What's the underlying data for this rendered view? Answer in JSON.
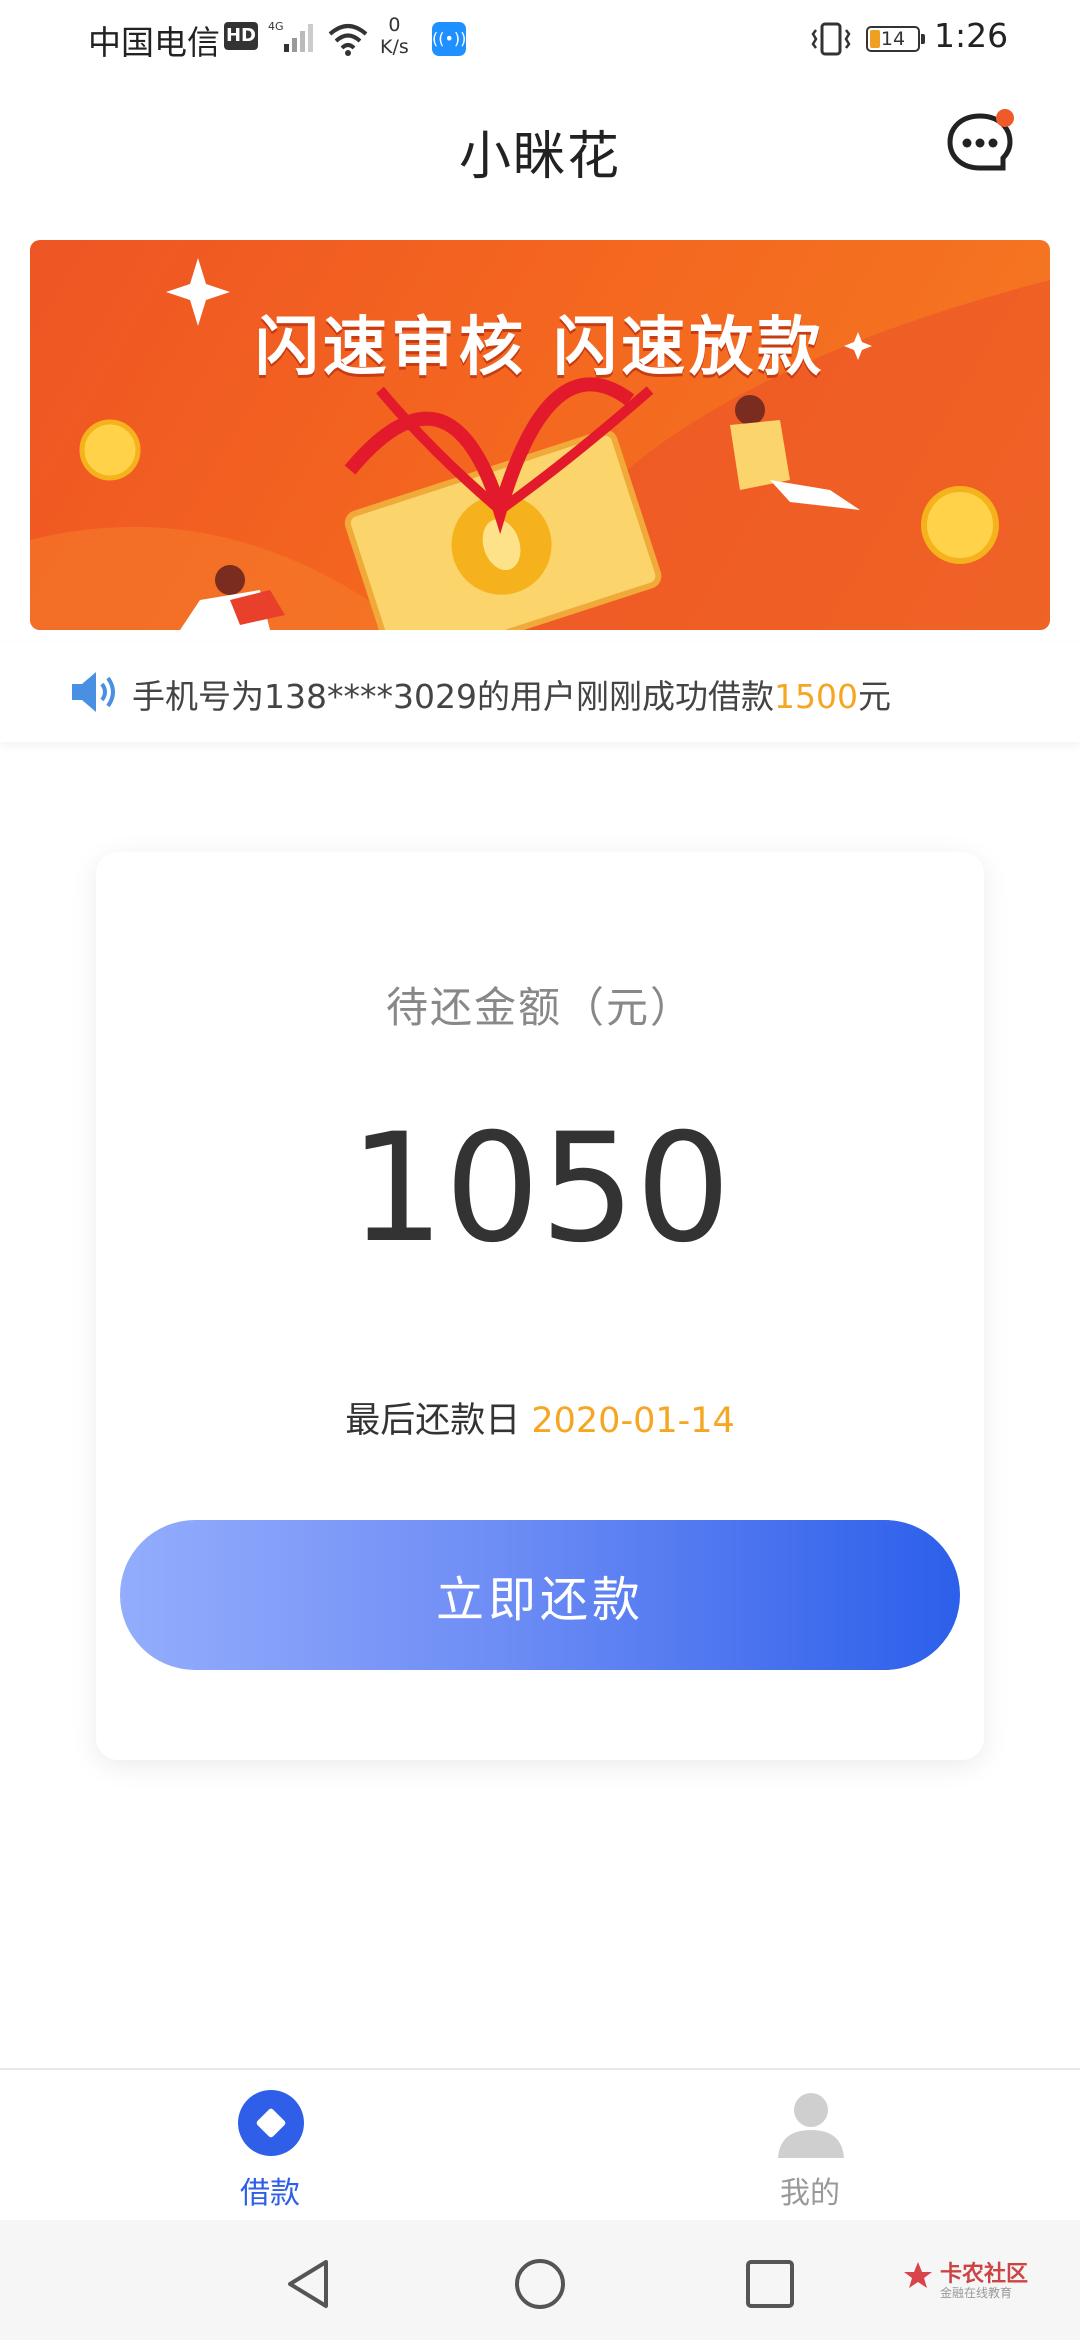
{
  "status_bar": {
    "carrier": "中国电信",
    "hd": "HD",
    "network": "4G",
    "speed_value": "0",
    "speed_unit": "K/s",
    "battery": "14",
    "time": "1:26"
  },
  "header": {
    "title": "小眯花",
    "message_icon": "chat-bubble-icon",
    "has_unread": true
  },
  "banner": {
    "headline": "闪速审核 闪速放款"
  },
  "ticker": {
    "icon": "speaker-icon",
    "prefix": "手机号为138****3029的用户刚刚成功借款",
    "amount": "1500",
    "suffix": "元"
  },
  "repayment_card": {
    "label": "待还金额（元）",
    "amount": "1050",
    "due_label": "最后还款日",
    "due_date": "2020-01-14",
    "button_label": "立即还款"
  },
  "bottom_nav": {
    "items": [
      {
        "label": "借款",
        "icon": "loan-icon",
        "active": true
      },
      {
        "label": "我的",
        "icon": "profile-icon",
        "active": false
      }
    ]
  },
  "watermark": {
    "text": "卡农社区",
    "sub": "金融在线教育"
  },
  "colors": {
    "accent_blue": "#2f5fe8",
    "highlight_orange": "#f5a623",
    "banner_orange": "#ee5524"
  }
}
